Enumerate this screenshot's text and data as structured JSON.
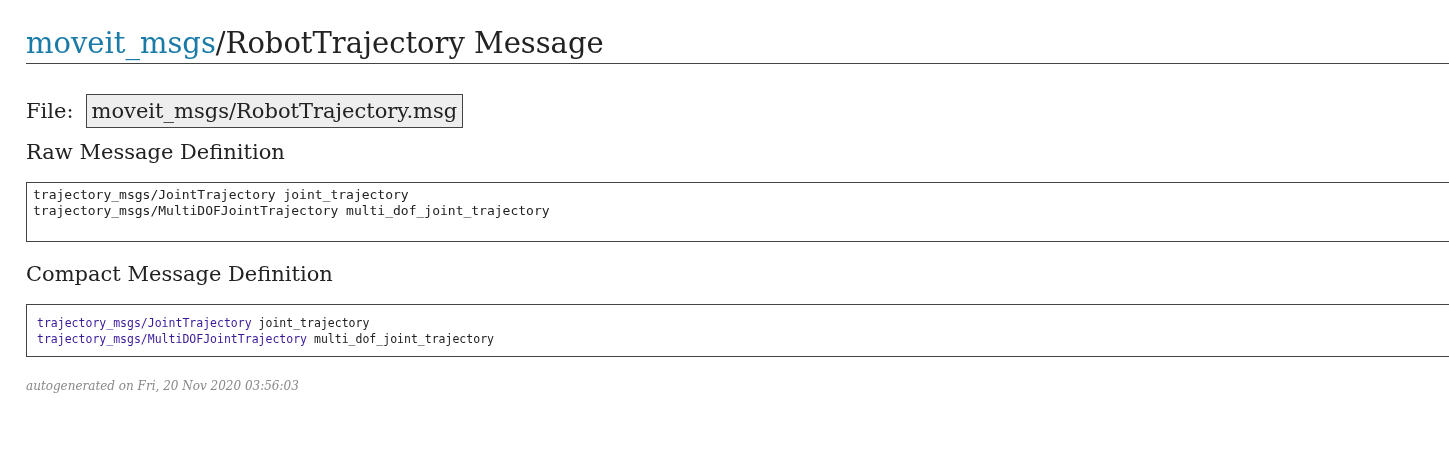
{
  "title": {
    "package_link": "moveit_msgs",
    "separator": "/",
    "name": "RobotTrajectory Message"
  },
  "file": {
    "label": "File:",
    "path": "moveit_msgs/RobotTrajectory.msg"
  },
  "raw_section": {
    "heading": "Raw Message Definition",
    "lines": [
      "trajectory_msgs/JointTrajectory joint_trajectory",
      "trajectory_msgs/MultiDOFJointTrajectory multi_dof_joint_trajectory"
    ]
  },
  "compact_section": {
    "heading": "Compact Message Definition",
    "fields": [
      {
        "type_link": "trajectory_msgs/JointTrajectory",
        "name": "joint_trajectory"
      },
      {
        "type_link": "trajectory_msgs/MultiDOFJointTrajectory",
        "name": "multi_dof_joint_trajectory"
      }
    ]
  },
  "footer": "autogenerated on Fri, 20 Nov 2020 03:56:03"
}
